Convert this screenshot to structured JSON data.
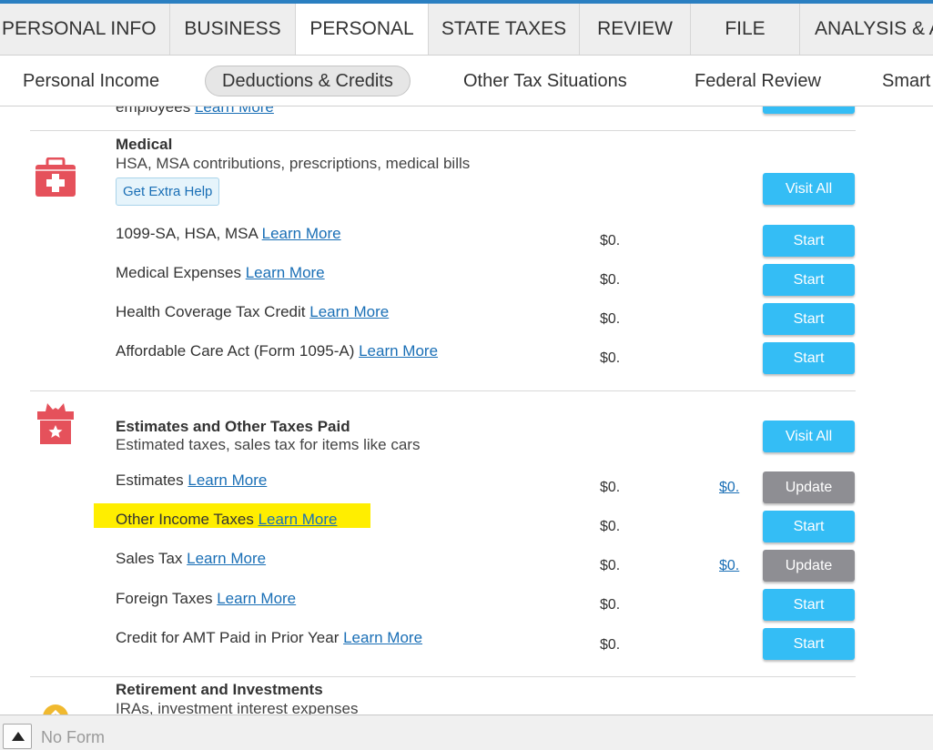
{
  "top_tabs": [
    {
      "label": "PERSONAL INFO"
    },
    {
      "label": "BUSINESS"
    },
    {
      "label": "PERSONAL"
    },
    {
      "label": "STATE TAXES"
    },
    {
      "label": "REVIEW"
    },
    {
      "label": "FILE"
    },
    {
      "label": "ANALYSIS & A"
    }
  ],
  "sub_nav": [
    {
      "label": "Personal Income"
    },
    {
      "label": "Deductions & Credits"
    },
    {
      "label": "Other Tax Situations"
    },
    {
      "label": "Federal Review"
    },
    {
      "label": "Smart"
    }
  ],
  "partial_row": {
    "label": "employees",
    "learn": "Learn More"
  },
  "medical": {
    "title": "Medical",
    "subtitle": "HSA, MSA contributions, prescriptions, medical bills",
    "extra_help": "Get Extra Help",
    "visit_all": "Visit All",
    "rows": [
      {
        "label": "1099-SA, HSA, MSA",
        "learn": "Learn More",
        "amount": "$0.",
        "button": "Start"
      },
      {
        "label": "Medical Expenses",
        "learn": "Learn More",
        "amount": "$0.",
        "button": "Start"
      },
      {
        "label": "Health Coverage Tax Credit",
        "learn": "Learn More",
        "amount": "$0.",
        "button": "Start"
      },
      {
        "label": "Affordable Care Act (Form 1095-A)",
        "learn": "Learn More",
        "amount": "$0.",
        "button": "Start"
      }
    ]
  },
  "estimates": {
    "title": "Estimates and Other Taxes Paid",
    "subtitle": "Estimated taxes, sales tax for items like cars",
    "visit_all": "Visit All",
    "rows": [
      {
        "label": "Estimates",
        "learn": "Learn More",
        "amount": "$0.",
        "amount_link": "$0.",
        "button": "Update"
      },
      {
        "label": "Other Income Taxes",
        "learn": "Learn More",
        "amount": "$0.",
        "button": "Start"
      },
      {
        "label": "Sales Tax",
        "learn": "Learn More",
        "amount": "$0.",
        "amount_link": "$0.",
        "button": "Update"
      },
      {
        "label": "Foreign Taxes",
        "learn": "Learn More",
        "amount": "$0.",
        "button": "Start"
      },
      {
        "label": "Credit for AMT Paid in Prior Year",
        "learn": "Learn More",
        "amount": "$0.",
        "button": "Start"
      }
    ]
  },
  "retirement": {
    "title": "Retirement and Investments",
    "subtitle": "IRAs, investment interest expenses"
  },
  "bottom_bar": {
    "no_form": "No Form"
  },
  "colors": {
    "accent_blue": "#34bdf5",
    "update_gray": "#8e8e93",
    "link_blue": "#1a6fb6",
    "icon_red": "#e5515b",
    "highlight_yellow": "#ffee00"
  }
}
